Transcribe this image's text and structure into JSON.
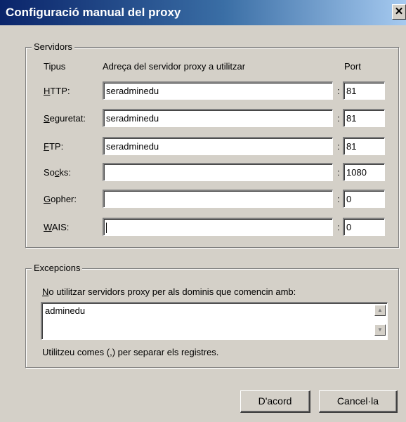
{
  "window": {
    "title": "Configuració manual del proxy",
    "close_glyph": "✕"
  },
  "servers": {
    "legend": "Servidors",
    "col_type": "Tipus",
    "col_address": "Adreça del servidor proxy a utilitzar",
    "col_port": "Port",
    "separator": ":",
    "rows": [
      {
        "label": "HTTP:",
        "accel": "H",
        "label_rest": "TTP:",
        "address": "seradminedu",
        "port": "81"
      },
      {
        "label": "Seguretat:",
        "accel": "S",
        "label_rest": "eguretat:",
        "address": "seradminedu",
        "port": "81"
      },
      {
        "label": "FTP:",
        "accel": "F",
        "label_rest": "TP:",
        "address": "seradminedu",
        "port": "81"
      },
      {
        "label": "Socks:",
        "accel_pre": "So",
        "accel": "c",
        "label_rest": "ks:",
        "address": "",
        "port": "1080"
      },
      {
        "label": "Gopher:",
        "accel": "G",
        "label_rest": "opher:",
        "address": "",
        "port": "0"
      },
      {
        "label": "WAIS:",
        "accel": "W",
        "label_rest": "AIS:",
        "address": "",
        "port": "0"
      }
    ]
  },
  "exceptions": {
    "legend": "Excepcions",
    "instruction_accel": "N",
    "instruction_rest": "o utilitzar servidors proxy per als dominis que comencin amb:",
    "value": "adminedu",
    "hint": "Utilitzeu comes (,) per separar els registres."
  },
  "buttons": {
    "ok": "D'acord",
    "cancel": "Cancel·la"
  },
  "colors": {
    "face": "#d4d0c8",
    "title_start": "#0a246a",
    "title_end": "#a6caf0"
  }
}
